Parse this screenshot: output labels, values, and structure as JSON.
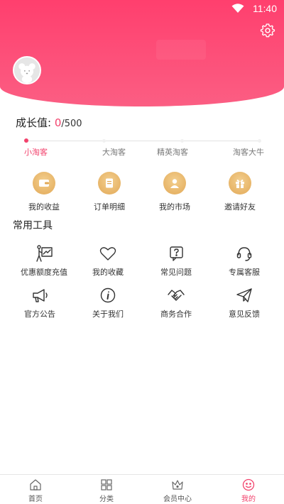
{
  "status_bar": {
    "time": "11:40"
  },
  "growth": {
    "label": "成长值: ",
    "current": "0",
    "max": "/500"
  },
  "levels": [
    "小淘客",
    "大淘客",
    "精英淘客",
    "淘客大牛"
  ],
  "quick_actions": [
    {
      "label": "我的收益",
      "icon": "wallet-icon"
    },
    {
      "label": "订单明细",
      "icon": "order-list-icon"
    },
    {
      "label": "我的市场",
      "icon": "market-user-icon"
    },
    {
      "label": "邀请好友",
      "icon": "gift-icon"
    }
  ],
  "tools_title": "常用工具",
  "tools": [
    {
      "label": "优惠额度充值",
      "icon": "recharge-chart-icon"
    },
    {
      "label": "我的收藏",
      "icon": "heart-icon"
    },
    {
      "label": "常见问题",
      "icon": "question-icon"
    },
    {
      "label": "专属客服",
      "icon": "headset-icon"
    },
    {
      "label": "官方公告",
      "icon": "megaphone-icon"
    },
    {
      "label": "关于我们",
      "icon": "info-icon"
    },
    {
      "label": "商务合作",
      "icon": "handshake-icon"
    },
    {
      "label": "意见反馈",
      "icon": "paper-plane-icon"
    }
  ],
  "tabs": [
    {
      "label": "首页",
      "icon": "home-icon"
    },
    {
      "label": "分类",
      "icon": "grid-icon"
    },
    {
      "label": "会员中心",
      "icon": "crown-icon"
    },
    {
      "label": "我的",
      "icon": "smile-icon"
    }
  ],
  "colors": {
    "accent": "#f2426c",
    "header_top": "#ff3f6e",
    "gold": "#e2a957"
  }
}
